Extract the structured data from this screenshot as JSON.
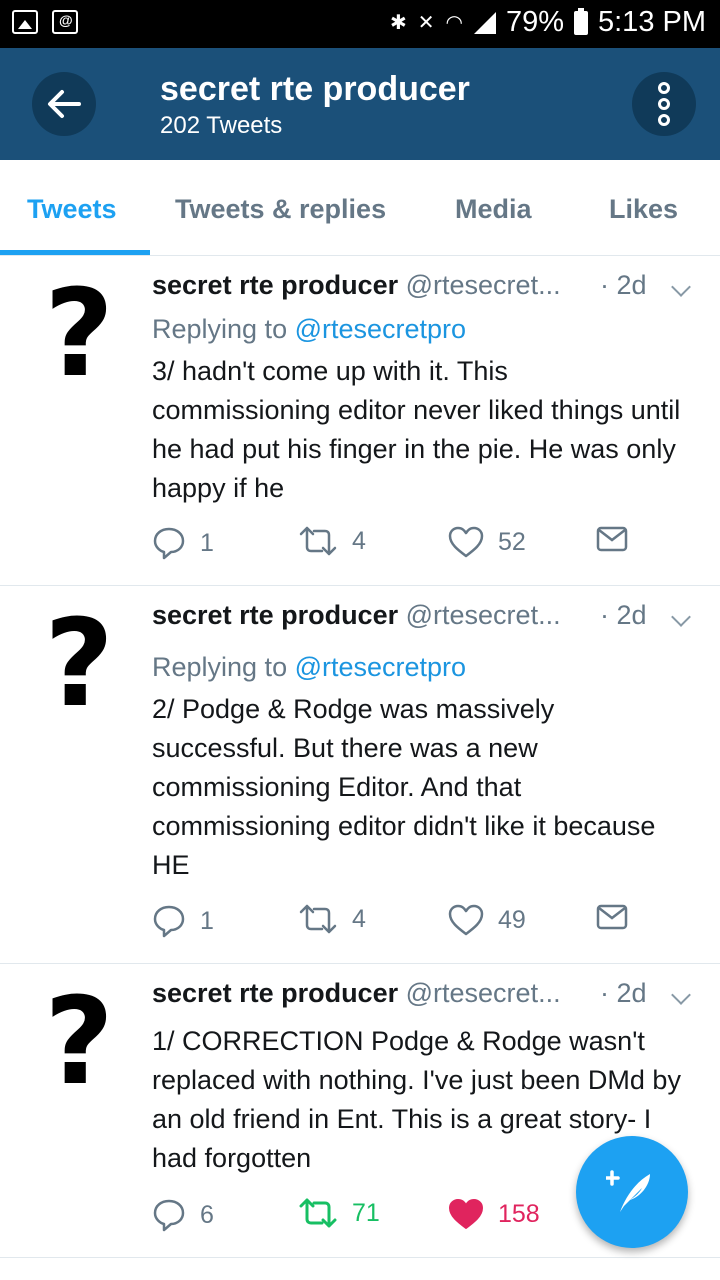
{
  "status_bar": {
    "battery": "79%",
    "time": "5:13 PM"
  },
  "header": {
    "title": "secret rte producer",
    "subtitle": "202 Tweets"
  },
  "tabs": [
    {
      "label": "Tweets",
      "active": true
    },
    {
      "label": "Tweets & replies",
      "active": false
    },
    {
      "label": "Media",
      "active": false
    },
    {
      "label": "Likes",
      "active": false
    }
  ],
  "tweets": [
    {
      "avatar_glyph": "?",
      "name": "secret rte producer",
      "handle": "@rtesecret...",
      "time": "· 2d",
      "reply_prefix": "Replying to ",
      "reply_to": "@rtesecretpro",
      "text": "3/ hadn't come up with it. This commissioning editor never liked things until he had put his finger in the pie. He was only happy if he",
      "replies": "1",
      "retweets": "4",
      "likes": "52",
      "liked": false,
      "retweeted": false
    },
    {
      "avatar_glyph": "?",
      "name": "secret rte producer",
      "handle": "@rtesecret...",
      "time": "· 2d",
      "reply_prefix": "Replying to ",
      "reply_to": "@rtesecretpro",
      "text": "2/ Podge & Rodge was massively successful. But there was a new commissioning Editor. And that commissioning editor didn't like it because HE",
      "replies": "1",
      "retweets": "4",
      "likes": "49",
      "liked": false,
      "retweeted": false
    },
    {
      "avatar_glyph": "?",
      "name": "secret rte producer",
      "handle": "@rtesecret...",
      "time": "· 2d",
      "text": "1/ CORRECTION Podge & Rodge wasn't replaced with nothing. I've just been DMd by an old friend in Ent. This is a great story- I had forgotten",
      "replies": "6",
      "retweets": "71",
      "likes": "158",
      "liked": true,
      "retweeted": true
    }
  ],
  "colors": {
    "header_bg": "#1b5079",
    "accent": "#1da1f2",
    "like_active": "#e0245e",
    "retweet_active": "#17bf63",
    "muted": "#657786"
  }
}
